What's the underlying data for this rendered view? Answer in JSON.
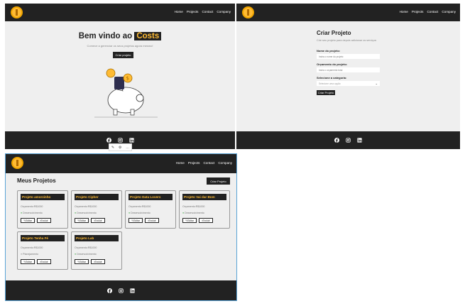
{
  "nav": {
    "links": [
      "Home",
      "Projects",
      "Contact",
      "Company"
    ]
  },
  "home": {
    "title_prefix": "Bem vindo ao",
    "title_brand": "Costs",
    "subtitle": "Comece a gerenciar os seus projetos agora mesmo!",
    "cta": "Criar projeto",
    "toolbar": [
      "✎",
      "⚙",
      "…"
    ]
  },
  "create": {
    "title": "Criar Projeto",
    "subtitle": "Crie seu projeto para depois adicionar os serviços",
    "name_label": "Nome do projeto:",
    "name_placeholder": "Insira o nome do projeto",
    "budget_label": "Orçamento do projeto:",
    "budget_placeholder": "Insira o orçamento total",
    "category_label": "Selecione a categoria:",
    "category_selected": "Selecione uma opção",
    "submit": "Criar Projeto"
  },
  "projects": {
    "title": "Meus Projetos",
    "new_button": "Criar Projeto",
    "budget_prefix": "Orçamento:",
    "edit_label": "Editar",
    "delete_label": "Excluir",
    "items": [
      {
        "name": "Projeto amorzinho",
        "budget": "R$1000",
        "category": "Desenvolvimento",
        "dot_color": "#4caf50"
      },
      {
        "name": "Projeto Cipher",
        "budget": "R$1000",
        "category": "Desenvolvimento",
        "dot_color": "#4caf50"
      },
      {
        "name": "Projeto Data Lovers",
        "budget": "R$1000",
        "category": "Desenvolvimento",
        "dot_color": "#4caf50"
      },
      {
        "name": "Projeto Vai dar Bom",
        "budget": "R$1000",
        "category": "Desenvolvimento",
        "dot_color": "#4caf50"
      },
      {
        "name": "Projeto Tenha Fé",
        "budget": "R$1000",
        "category": "Planejamento",
        "dot_color": "#9e9e9e"
      },
      {
        "name": "Projeto Lab",
        "budget": "R$1000",
        "category": "Desenvolvimento",
        "dot_color": "#4caf50"
      }
    ]
  },
  "footer": {
    "icons": [
      "facebook-icon",
      "instagram-icon",
      "linkedin-icon"
    ]
  },
  "colors": {
    "dark": "#222222",
    "accent": "#ffbb33",
    "background": "#efefef"
  }
}
